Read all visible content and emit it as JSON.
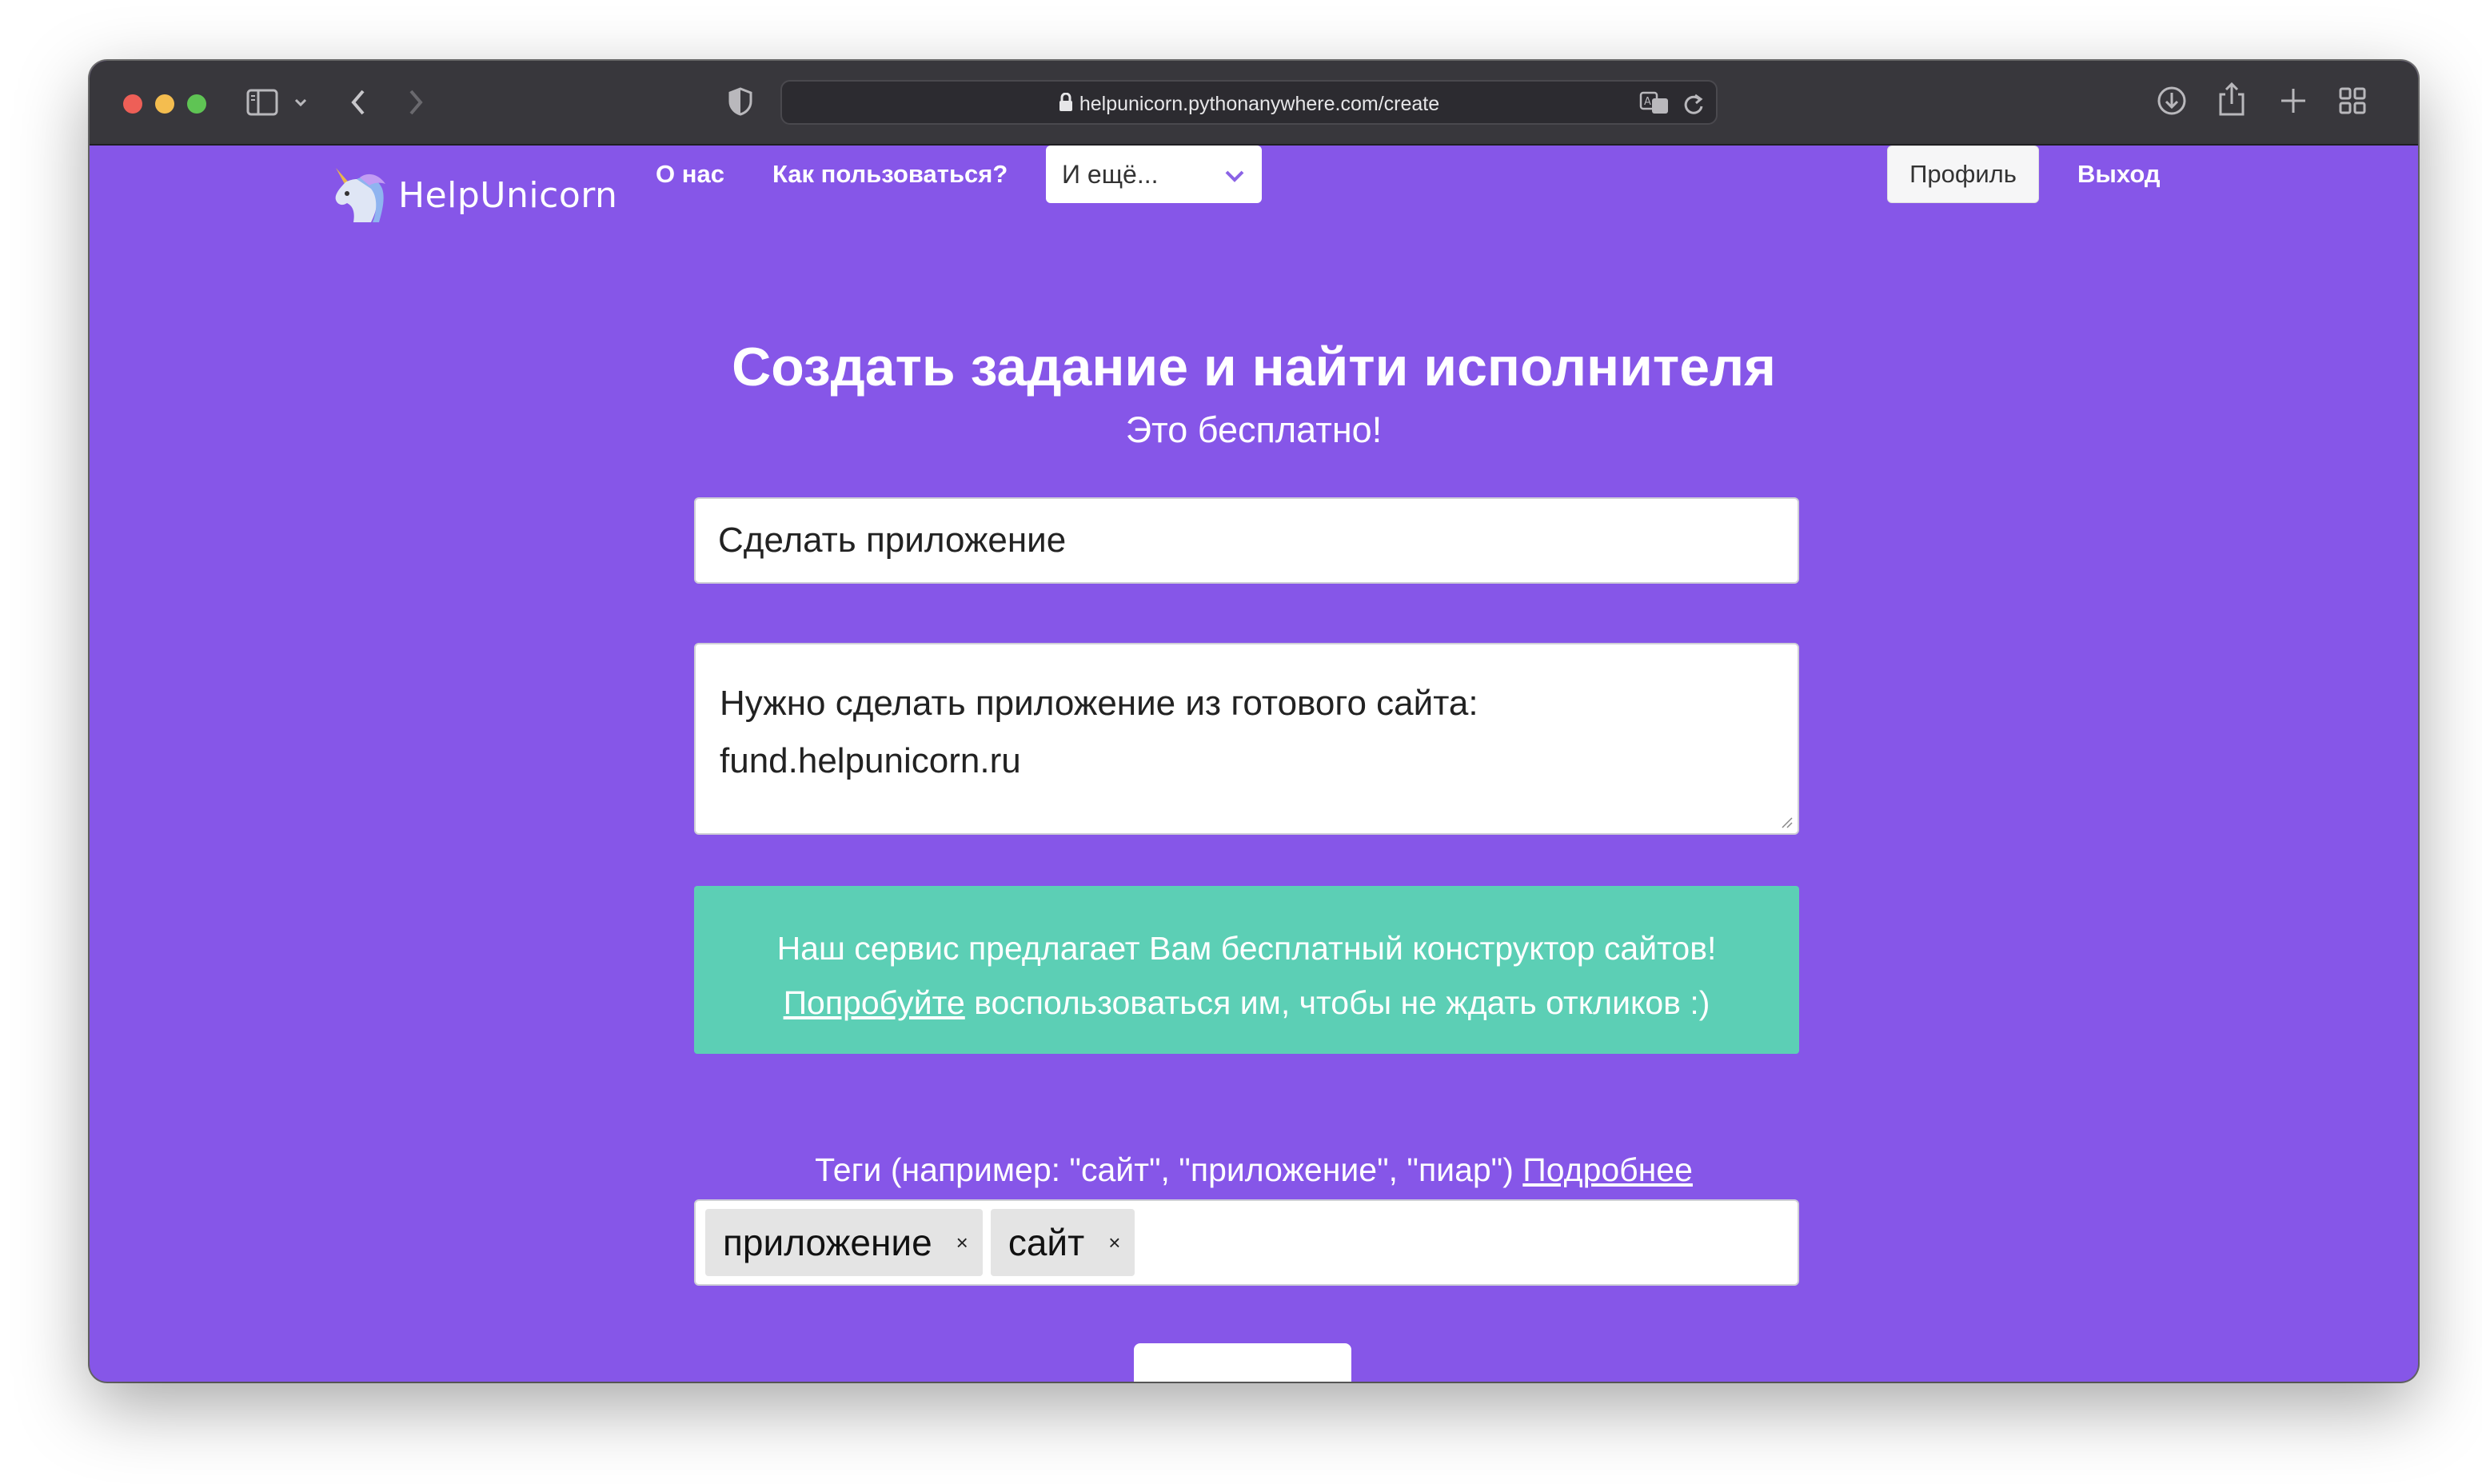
{
  "browser": {
    "url": "helpunicorn.pythonanywhere.com/create"
  },
  "nav": {
    "brand": "HelpUnicorn",
    "about": "О нас",
    "howto": "Как пользоваться?",
    "more_select": "И ещё...",
    "profile": "Профиль",
    "logout": "Выход"
  },
  "main": {
    "title": "Создать задание и найти исполнителя",
    "subtitle": "Это бесплатно!",
    "task_title_value": "Сделать приложение",
    "description_line1": "Нужно сделать приложение из готового сайта:",
    "description_line2": "fund.helpunicorn.ru",
    "promo_line1": "Наш сервис предлагает Вам бесплатный конструктор сайтов!",
    "promo_link": "Попробуйте",
    "promo_line2_rest": " воспользоваться им, чтобы не ждать откликов :)",
    "tags_label": "Теги (например: \"сайт\", \"приложение\", \"пиар\") ",
    "tags_more_link": "Подробнее",
    "tags": [
      "приложение",
      "сайт"
    ],
    "tag_remove": "×"
  },
  "colors": {
    "page_bg": "#8656e8",
    "promo_bg": "#5ccfb5",
    "toolbar_bg": "#38373c"
  }
}
